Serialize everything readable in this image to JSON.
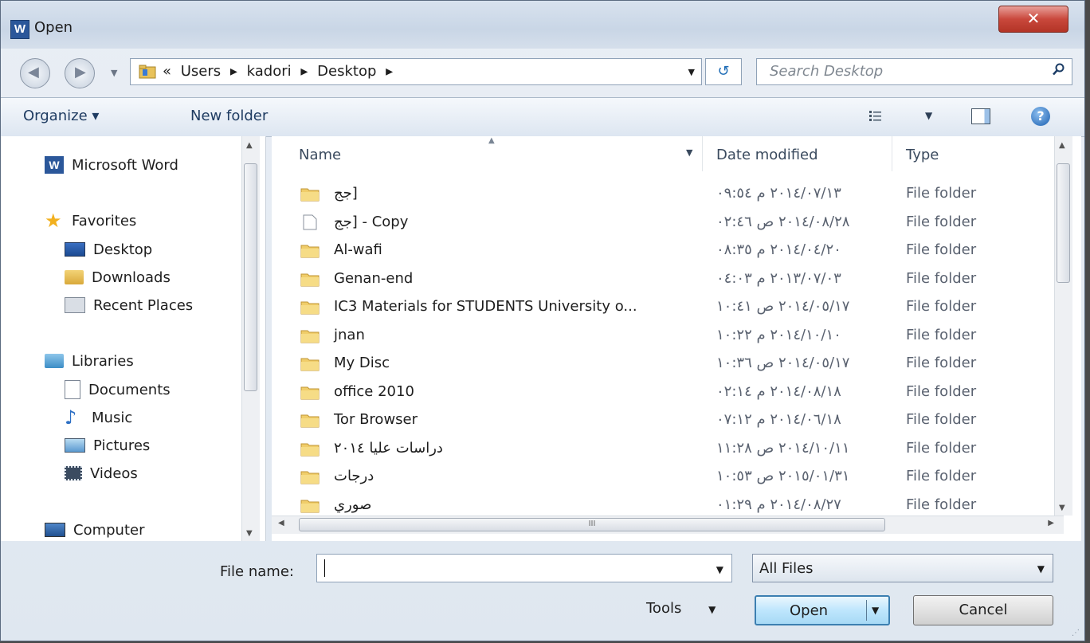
{
  "window": {
    "title": "Open",
    "app_icon": "W"
  },
  "address": {
    "crumbs": [
      "«",
      "Users",
      "kadori",
      "Desktop"
    ],
    "separator": "▸"
  },
  "search": {
    "placeholder": "Search Desktop"
  },
  "toolbar": {
    "organize": "Organize ▾",
    "new_folder": "New folder"
  },
  "nav": {
    "word": "Microsoft Word",
    "favorites": "Favorites",
    "desktop": "Desktop",
    "downloads": "Downloads",
    "recent": "Recent Places",
    "libraries": "Libraries",
    "documents": "Documents",
    "music": "Music",
    "pictures": "Pictures",
    "videos": "Videos",
    "computer": "Computer"
  },
  "columns": {
    "name": "Name",
    "date": "Date modified",
    "type": "Type"
  },
  "files": [
    {
      "name": "جج]",
      "date": "٢٠١٤/٠٧/١٣ م ٠٩:٥٤",
      "type": "File folder",
      "icon": "folder"
    },
    {
      "name": "جج] - Copy",
      "date": "٢٠١٤/٠٨/٢٨ ص ٠٢:٤٦",
      "type": "File folder",
      "icon": "document"
    },
    {
      "name": "Al-wafi",
      "date": "٢٠١٤/٠٤/٢٠ م ٠٨:٣٥",
      "type": "File folder",
      "icon": "folder"
    },
    {
      "name": "Genan-end",
      "date": "٢٠١٣/٠٧/٠٣ م ٠٤:٠٣",
      "type": "File folder",
      "icon": "folder"
    },
    {
      "name": "IC3 Materials for STUDENTS University o...",
      "date": "٢٠١٤/٠٥/١٧ ص ١٠:٤١",
      "type": "File folder",
      "icon": "folder"
    },
    {
      "name": "jnan",
      "date": "٢٠١٤/١٠/١٠ م ١٠:٢٢",
      "type": "File folder",
      "icon": "folder"
    },
    {
      "name": "My Disc",
      "date": "٢٠١٤/٠٥/١٧ ص ١٠:٣٦",
      "type": "File folder",
      "icon": "folder"
    },
    {
      "name": "office 2010",
      "date": "٢٠١٤/٠٨/١٨ م ٠٢:١٤",
      "type": "File folder",
      "icon": "folder"
    },
    {
      "name": "Tor Browser",
      "date": "٢٠١٤/٠٦/١٨ م ٠٧:١٢",
      "type": "File folder",
      "icon": "folder"
    },
    {
      "name": "دراسات عليا ٢٠١٤",
      "date": "٢٠١٤/١٠/١١ ص ١١:٢٨",
      "type": "File folder",
      "icon": "folder"
    },
    {
      "name": "درجات",
      "date": "٢٠١٥/٠١/٣١ ص ١٠:٥٣",
      "type": "File folder",
      "icon": "folder"
    },
    {
      "name": "صوري",
      "date": "٢٠١٤/٠٨/٢٧ م ٠١:٢٩",
      "type": "File folder",
      "icon": "folder"
    }
  ],
  "bottom": {
    "file_name_label": "File name:",
    "file_name_value": "",
    "filter": "All Files",
    "tools": "Tools",
    "open": "Open",
    "cancel": "Cancel"
  }
}
